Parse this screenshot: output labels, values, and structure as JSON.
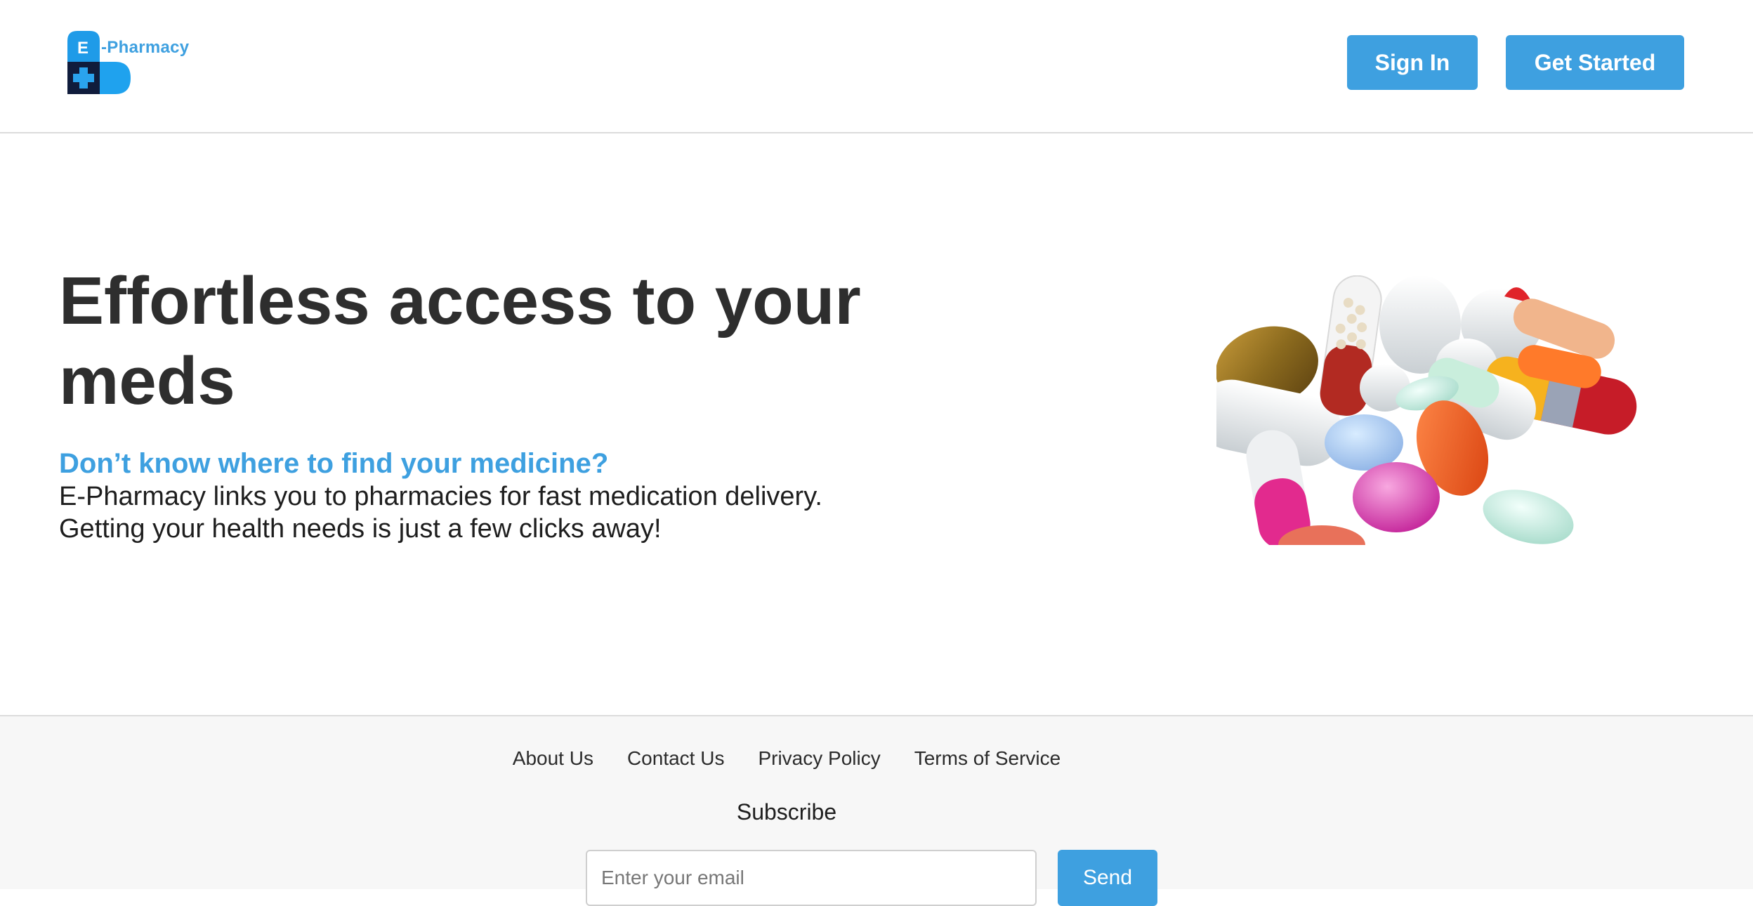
{
  "brand": {
    "logo_letter": "E",
    "logo_dash": "-",
    "logo_name": "Pharmacy",
    "primary_color": "#3ea0e0"
  },
  "header": {
    "sign_in_label": "Sign In",
    "get_started_label": "Get Started"
  },
  "hero": {
    "title": "Effortless access to your meds",
    "question": "Don’t know where to find your medicine?",
    "line1": "E-Pharmacy links you to pharmacies for fast medication delivery.",
    "line2": "Getting your health needs is just a few clicks away!",
    "image_icon": "pills-image"
  },
  "footer": {
    "links": [
      "About Us",
      "Contact Us",
      "Privacy Policy",
      "Terms of Service"
    ],
    "subscribe_title": "Subscribe",
    "email_placeholder": "Enter your email",
    "send_label": "Send"
  }
}
